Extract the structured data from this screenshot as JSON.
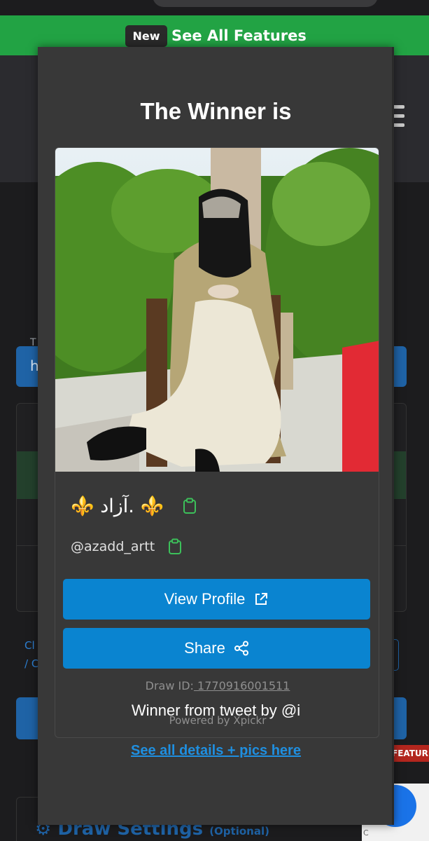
{
  "banner": {
    "badge": "New",
    "text": "See All Features"
  },
  "background": {
    "input_label": "T",
    "input_value": "h",
    "link_line1": "Cl",
    "link_line2": "/ C",
    "feature_tag": "FEATURE",
    "settings_title": "Draw Settings",
    "settings_note": "(Optional)",
    "recaptcha_text": "C"
  },
  "modal": {
    "title": "The Winner is",
    "winner_name": "⚜️ آزاد. ⚜️",
    "winner_handle": "@azadd_artt",
    "view_profile_label": "View Profile",
    "share_label": "Share",
    "draw_id_label": "Draw ID:",
    "draw_id_value": " 1770916001511",
    "powered_by": "Powered by Xpickr",
    "winner_from": "Winner from tweet by @i",
    "details_link": "See all details + pics here"
  },
  "colors": {
    "accent": "#0a84d0",
    "banner": "#22a344",
    "clipboard": "#3cc05a"
  }
}
